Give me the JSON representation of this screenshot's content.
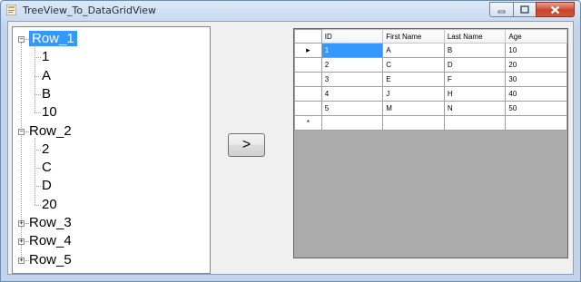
{
  "window": {
    "title": "TreeView_To_DataGridView",
    "minimize_label": "–",
    "maximize_label": "▢",
    "close_label": "✕"
  },
  "tree": {
    "nodes": [
      {
        "label": "Row_1",
        "selected": true,
        "expanded": true,
        "children": [
          "1",
          "A",
          "B",
          "10"
        ]
      },
      {
        "label": "Row_2",
        "selected": false,
        "expanded": true,
        "children": [
          "2",
          "C",
          "D",
          "20"
        ]
      },
      {
        "label": "Row_3",
        "selected": false,
        "expanded": false,
        "children": []
      },
      {
        "label": "Row_4",
        "selected": false,
        "expanded": false,
        "children": []
      },
      {
        "label": "Row_5",
        "selected": false,
        "expanded": false,
        "children": []
      }
    ],
    "collapse_glyph": "−",
    "expand_glyph": "+"
  },
  "transfer_button": {
    "label": ">"
  },
  "grid": {
    "columns": [
      "ID",
      "First Name",
      "Last Name",
      "Age"
    ],
    "rows": [
      [
        "1",
        "A",
        "B",
        "10"
      ],
      [
        "2",
        "C",
        "D",
        "20"
      ],
      [
        "3",
        "E",
        "F",
        "30"
      ],
      [
        "4",
        "J",
        "H",
        "40"
      ],
      [
        "5",
        "M",
        "N",
        "50"
      ]
    ],
    "current_row_marker": "▸",
    "new_row_marker": "*",
    "selected_color": "#3399ff"
  }
}
